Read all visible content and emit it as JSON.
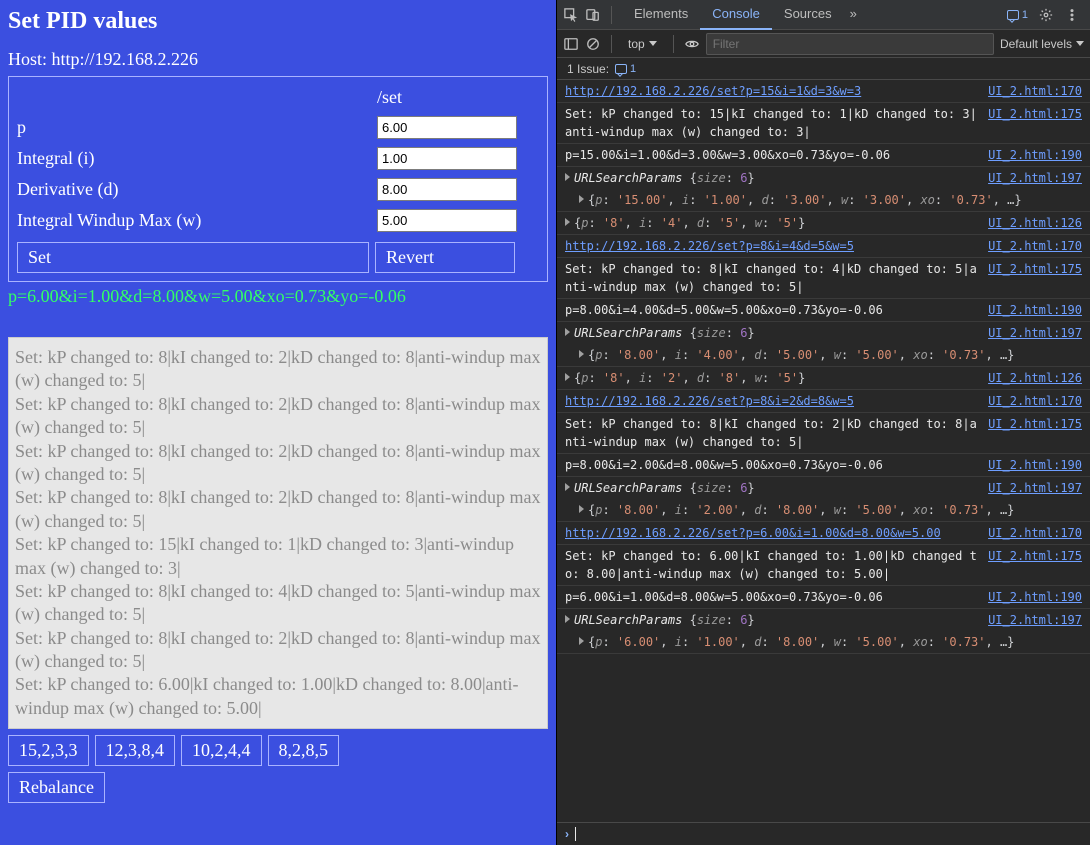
{
  "app": {
    "title": "Set PID values",
    "host_prefix": "Host: ",
    "host_url": "http://192.168.2.226",
    "endpoint": "/set",
    "rows": {
      "p": {
        "label": "p",
        "value": "6.00"
      },
      "i": {
        "label": "Integral (i)",
        "value": "1.00"
      },
      "d": {
        "label": "Derivative (d)",
        "value": "8.00"
      },
      "w": {
        "label": "Integral Windup Max (w)",
        "value": "5.00"
      }
    },
    "buttons": {
      "set": "Set",
      "revert": "Revert"
    },
    "query_output": "p=6.00&i=1.00&d=8.00&w=5.00&xo=0.73&yo=-0.06",
    "presets": [
      "15,2,3,3",
      "12,3,8,4",
      "10,2,4,4",
      "8,2,8,5"
    ],
    "rebalance": "Rebalance",
    "log": [
      "Set: kP changed to: 8|kI changed to: 2|kD changed to: 8|anti-windup max (w) changed to: 5|",
      "Set: kP changed to: 8|kI changed to: 2|kD changed to: 8|anti-windup max (w) changed to: 5|",
      "Set: kP changed to: 8|kI changed to: 2|kD changed to: 8|anti-windup max (w) changed to: 5|",
      "Set: kP changed to: 8|kI changed to: 2|kD changed to: 8|anti-windup max (w) changed to: 5|",
      "Set: kP changed to: 15|kI changed to: 1|kD changed to: 3|anti-windup max (w) changed to: 3|",
      "Set: kP changed to: 8|kI changed to: 4|kD changed to: 5|anti-windup max (w) changed to: 5|",
      "Set: kP changed to: 8|kI changed to: 2|kD changed to: 8|anti-windup max (w) changed to: 5|",
      "Set: kP changed to: 6.00|kI changed to: 1.00|kD changed to: 8.00|anti-windup max (w) changed to: 5.00|"
    ]
  },
  "devtools": {
    "tabs": {
      "elements": "Elements",
      "console": "Console",
      "sources": "Sources"
    },
    "badge_count": "1",
    "context": "top",
    "filter_placeholder": "Filter",
    "levels": "Default levels",
    "issues_label": "1 Issue:",
    "issues_count": "1",
    "src": {
      "l126": "UI_2.html:126",
      "l170": "UI_2.html:170",
      "l175": "UI_2.html:175",
      "l190": "UI_2.html:190",
      "l197": "UI_2.html:197"
    },
    "lines": {
      "cut_url": "http://192.168.2.226/set?p=15&i=1&d=3&w=3",
      "set15": "Set: kP changed to: 15|kI changed to: 1|kD changed to: 3|anti-windup max (w) changed to: 3|",
      "q15": "p=15.00&i=1.00&d=3.00&w=3.00&xo=0.73&yo=-0.06",
      "usp6": "URLSearchParams",
      "size6": "size",
      "six": "6",
      "usp15obj_p": "'15.00'",
      "usp15obj_i": "'1.00'",
      "usp15obj_d": "'3.00'",
      "usp15obj_w": "'3.00'",
      "usp15obj_xo": "'0.73'",
      "obj845": "{p: '8', i: '4', d: '5', w: '5'}",
      "url845": "http://192.168.2.226/set?p=8&i=4&d=5&w=5",
      "set845": "Set: kP changed to: 8|kI changed to: 4|kD changed to: 5|anti-windup max (w) changed to: 5|",
      "q845": "p=8.00&i=4.00&d=5.00&w=5.00&xo=0.73&yo=-0.06",
      "usp8obj_p": "'8.00'",
      "usp8obj_i": "'4.00'",
      "usp8obj_d": "'5.00'",
      "usp8obj_w": "'5.00'",
      "obj828": "{p: '8', i: '2', d: '8', w: '5'}",
      "url828": "http://192.168.2.226/set?p=8&i=2&d=8&w=5",
      "set828": "Set: kP changed to: 8|kI changed to: 2|kD changed to: 8|anti-windup max (w) changed to: 5|",
      "q828": "p=8.00&i=2.00&d=8.00&w=5.00&xo=0.73&yo=-0.06",
      "usp82obj_i": "'2.00'",
      "usp82obj_d": "'8.00'",
      "url6": "http://192.168.2.226/set?p=6.00&i=1.00&d=8.00&w=5.00",
      "set6": "Set: kP changed to: 6.00|kI changed to: 1.00|kD changed to: 8.00|anti-windup max (w) changed to: 5.00|",
      "q6": "p=6.00&i=1.00&d=8.00&w=5.00&xo=0.73&yo=-0.06",
      "usp6obj_p": "'6.00'",
      "usp6obj_i": "'1.00'",
      "usp6obj_d": "'8.00'",
      "usp6obj_w": "'5.00'"
    }
  }
}
